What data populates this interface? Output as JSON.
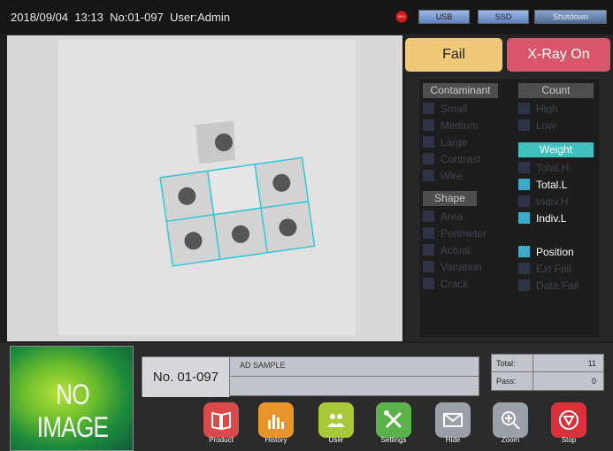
{
  "topbar": {
    "date": "2018/09/04",
    "time": "13:13",
    "number": "No:01-097",
    "user": "User:Admin",
    "rec_label": "REC",
    "usb_label": "USB",
    "ssd_label": "SSD",
    "shutdown_label": "Shutdown"
  },
  "status": {
    "fail_label": "Fail",
    "xray_label": "X-Ray On",
    "fail_color": "#efc978",
    "xray_color": "#d9566a"
  },
  "judgement": {
    "contaminant_header": "Contaminant",
    "contaminant": [
      {
        "label": "Small",
        "on": false
      },
      {
        "label": "Medium",
        "on": false
      },
      {
        "label": "Large",
        "on": false
      },
      {
        "label": "Contrast",
        "on": false
      },
      {
        "label": "Wire",
        "on": false
      }
    ],
    "shape_header": "Shape",
    "shape": [
      {
        "label": "Area",
        "on": false
      },
      {
        "label": "Perimeter",
        "on": false
      },
      {
        "label": "Actual",
        "on": false
      },
      {
        "label": "Variation",
        "on": false
      },
      {
        "label": "Crack",
        "on": false
      }
    ],
    "count_header": "Count",
    "count": [
      {
        "label": "High",
        "on": false
      },
      {
        "label": "Low",
        "on": false
      }
    ],
    "weight_header": "Weight",
    "weight": [
      {
        "label": "Total.H",
        "on": false
      },
      {
        "label": "Total.L",
        "on": true
      },
      {
        "label": "Indiv.H",
        "on": false
      },
      {
        "label": "Indiv.L",
        "on": true
      }
    ],
    "position": [
      {
        "label": "Position",
        "on": true
      },
      {
        "label": "Ext Fail",
        "on": false
      },
      {
        "label": "Data Fail",
        "on": false
      }
    ],
    "accent_color": "#3fc2bd"
  },
  "thumbnail": {
    "label": "NO IMAGE"
  },
  "product": {
    "number": "No. 01-097",
    "name": "AD SAMPLE"
  },
  "counts": {
    "total_label": "Total:",
    "total_value": "11",
    "pass_label": "Pass:",
    "pass_value": "0"
  },
  "toolbar": [
    {
      "label": "Product",
      "icon": "book-icon",
      "color": "#d94a4a"
    },
    {
      "label": "History",
      "icon": "bar-chart-icon",
      "color": "#e9942a"
    },
    {
      "label": "User",
      "icon": "users-icon",
      "color": "#a7c93a"
    },
    {
      "label": "Settings",
      "icon": "tools-icon",
      "color": "#5cb24a"
    },
    {
      "label": "Hide",
      "icon": "envelope-icon",
      "color": "#9aa0a8"
    },
    {
      "label": "Zoom",
      "icon": "zoom-in-icon",
      "color": "#9aa0a8"
    },
    {
      "label": "Stop",
      "icon": "stop-icon",
      "color": "#d9313a"
    }
  ]
}
